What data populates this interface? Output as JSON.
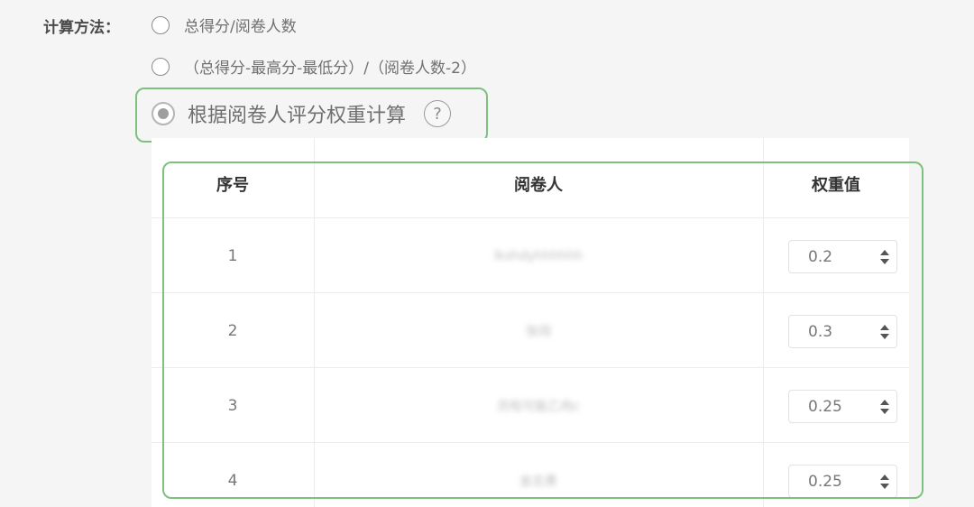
{
  "form": {
    "method_label": "计算方法：",
    "options": [
      {
        "label": "总得分/阅卷人数",
        "selected": false
      },
      {
        "label": "（总得分-最高分-最低分）/（阅卷人数-2）",
        "selected": false
      },
      {
        "label": "根据阅卷人评分权重计算",
        "selected": true
      }
    ],
    "help_icon": "?"
  },
  "table": {
    "headers": [
      "序号",
      "阅卷人",
      "权重值"
    ],
    "rows": [
      {
        "index": "1",
        "reviewer": "lkshdyhhhhhh",
        "weight": "0.2"
      },
      {
        "index": "2",
        "reviewer": "张闯",
        "weight": "0.3"
      },
      {
        "index": "3",
        "reviewer": "员啦可能乙肉c",
        "weight": "0.25"
      },
      {
        "index": "4",
        "reviewer": "金志勇",
        "weight": "0.25"
      }
    ]
  },
  "colors": {
    "highlight": "#7ec07e"
  }
}
